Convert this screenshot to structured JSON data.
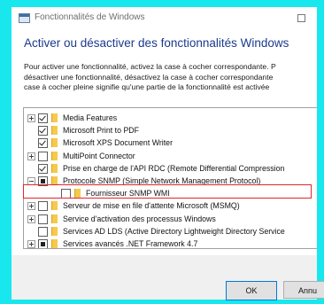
{
  "window": {
    "title": "Fonctionnalités de Windows"
  },
  "heading": "Activer ou désactiver des fonctionnalités Windows",
  "description": [
    "Pour activer une fonctionnalité, activez la case à cocher correspondante. P",
    "désactiver une fonctionnalité, désactivez la case à cocher correspondante",
    "case à cocher pleine signifie qu'une partie de la fonctionnalité est activée"
  ],
  "features": [
    {
      "label": "Media Features",
      "state": "checked",
      "expandable": true,
      "indent": 0
    },
    {
      "label": "Microsoft Print to PDF",
      "state": "checked",
      "expandable": false,
      "indent": 0
    },
    {
      "label": "Microsoft XPS Document Writer",
      "state": "checked",
      "expandable": false,
      "indent": 0
    },
    {
      "label": "MultiPoint Connector",
      "state": "unchecked",
      "expandable": true,
      "indent": 0
    },
    {
      "label": "Prise en charge de l'API RDC (Remote Differential Compression",
      "state": "checked",
      "expandable": false,
      "indent": 0
    },
    {
      "label": "Protocole SNMP (Simple Network Management Protocol)",
      "state": "partial",
      "expandable": true,
      "expanded": true,
      "indent": 0,
      "highlighted": true
    },
    {
      "label": "Fournisseur SNMP WMI",
      "state": "unchecked",
      "expandable": false,
      "indent": 1
    },
    {
      "label": "Serveur de mise en file d'attente Microsoft (MSMQ)",
      "state": "unchecked",
      "expandable": true,
      "indent": 0
    },
    {
      "label": "Service d'activation des processus Windows",
      "state": "unchecked",
      "expandable": true,
      "indent": 0
    },
    {
      "label": "Services AD LDS (Active Directory Lightweight Directory Service",
      "state": "unchecked",
      "expandable": false,
      "indent": 0
    },
    {
      "label": "Services avancés .NET Framework 4.7",
      "state": "partial",
      "expandable": true,
      "indent": 0
    }
  ],
  "buttons": {
    "ok": "OK",
    "cancel": "Annu"
  },
  "colors": {
    "background": "#19e7ee",
    "heading": "#1b3a8e",
    "highlight_border": "#e0262b",
    "folder": "#f5c94d"
  }
}
